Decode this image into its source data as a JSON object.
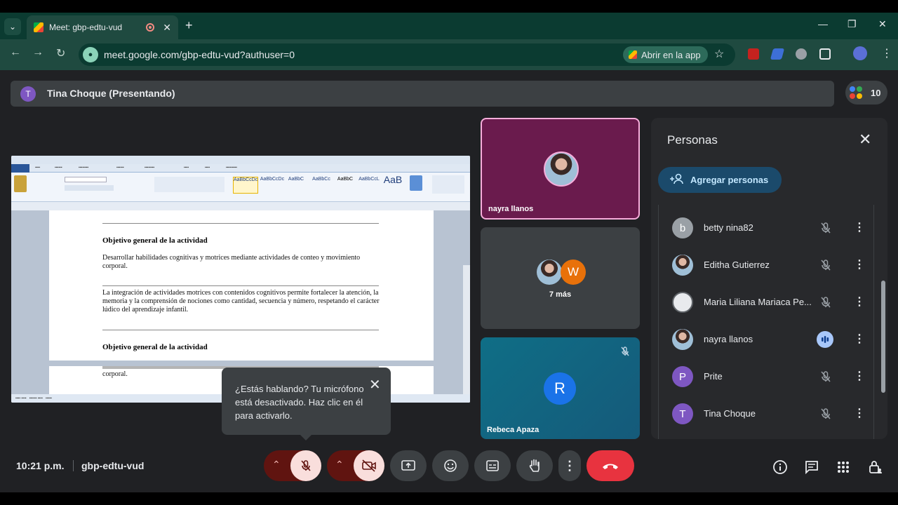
{
  "browser": {
    "tab_title": "Meet: gbp-edtu-vud",
    "url": "meet.google.com/gbp-edtu-vud?authuser=0",
    "open_app_label": "Abrir en la app"
  },
  "meet": {
    "presenting_banner": "Tina Choque (Presentando)",
    "presenter_initial": "T",
    "participant_count": "10",
    "time": "10:21 p.m.",
    "meeting_code": "gbp-edtu-vud"
  },
  "shared_doc": {
    "heading_1": "Objetivo general de la actividad",
    "para_1": "Desarrollar habilidades cognitivas y motrices mediante actividades de conteo y movimiento corporal.",
    "para_2": "La integración de actividades motrices con contenidos cognitivos permite fortalecer la atención, la memoria y la comprensión de nociones como cantidad, secuencia y número, respetando el carácter lúdico del aprendizaje infantil.",
    "heading_2": "Objetivo general de la actividad",
    "para_3": "corporal."
  },
  "tiles": {
    "tile_1_name": "nayra llanos",
    "tile_2_more": "7 más",
    "tile_2_initial": "W",
    "tile_3_name": "Rebeca Apaza",
    "tile_3_initial": "R"
  },
  "people_panel": {
    "title": "Personas",
    "add_label": "Agregar personas",
    "people": [
      {
        "name": "betty nina82",
        "initial": "b",
        "color": "#9aa0a6"
      },
      {
        "name": "Editha Gutierrez",
        "initial": "",
        "color": "#b07a62"
      },
      {
        "name": "Maria Liliana Mariaca Pe...",
        "initial": "",
        "color": "#e8eaed"
      },
      {
        "name": "nayra llanos",
        "initial": "",
        "color": "#8c7aa6"
      },
      {
        "name": "Prite",
        "initial": "P",
        "color": "#7e57c2"
      },
      {
        "name": "Tina Choque",
        "initial": "T",
        "color": "#7e57c2"
      }
    ]
  },
  "tooltip": {
    "text": "¿Estás hablando? Tu micrófono está desactivado. Haz clic en él para activarlo."
  },
  "colors": {
    "end_call": "#e8333f",
    "muted_control": "#f9dedc",
    "muted_arrow": "#8c1d18",
    "control_bg": "#3c4043"
  }
}
